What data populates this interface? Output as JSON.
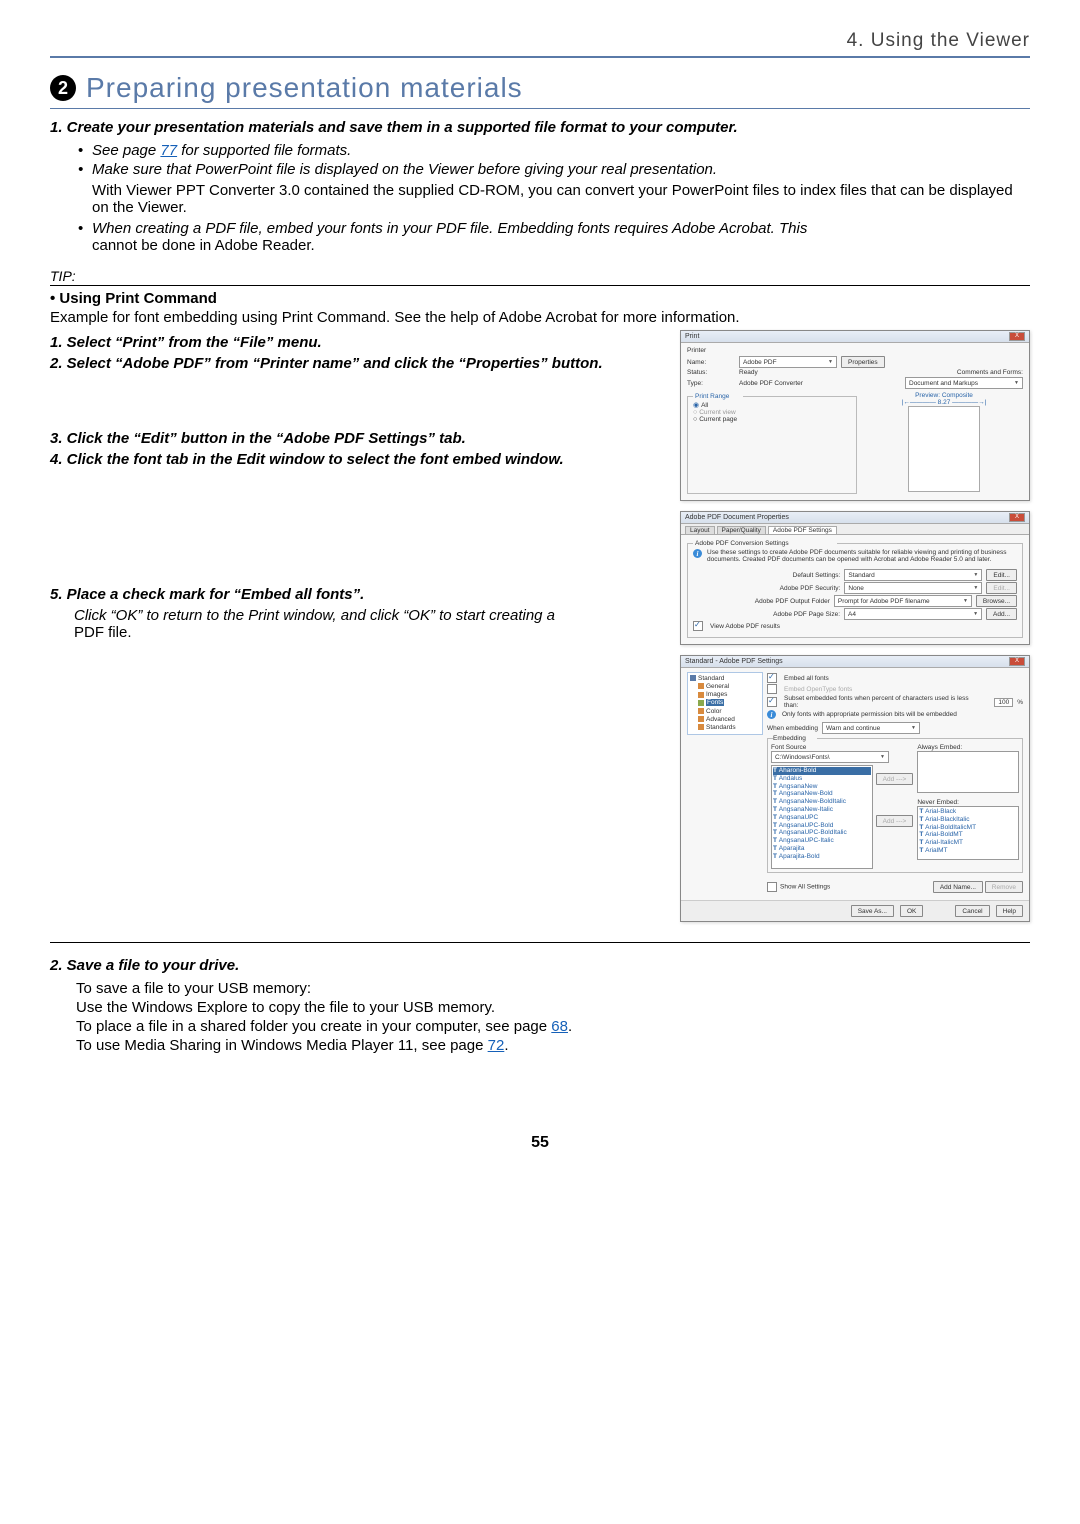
{
  "chapter": "4. Using the Viewer",
  "section_number": "2",
  "section_title": "Preparing presentation materials",
  "steps": {
    "s1": "1. Create your presentation materials and save them in a supported file format to your computer.",
    "bullet1_a": "See page ",
    "bullet1_page": "77",
    "bullet1_b": " for supported ﬁle formats.",
    "bullet2": "Make sure that PowerPoint file is displayed on the Viewer before giving your real presentation.",
    "bullet2_sub": "With Viewer PPT Converter 3.0 contained the supplied CD-ROM, you can convert your PowerPoint ﬁles to index ﬁles that can be displayed on the Viewer.",
    "bullet3_a": "When creating a PDF file, embed your fonts in your PDF file. Embedding fonts requires Adobe Acrobat. This ",
    "bullet3_b": "cannot be done in Adobe Reader."
  },
  "tip_label": "TIP:",
  "print_cmd_title": "• Using Print Command",
  "print_cmd_explain": "Example for font embedding using Print Command. See the help of Adobe Acrobat for more information.",
  "instr": {
    "s1": "1.  Select “Print” from the “File” menu.",
    "s2": "2.  Select “Adobe PDF” from “Printer name” and click the “Properties” button.",
    "s3": "3.  Click the “Edit” button in the “Adobe PDF Settings” tab.",
    "s4": "4.  Click the font tab in the Edit window to select the font embed window.",
    "s5": "5.  Place a check mark for “Embed all fonts”.",
    "s5_sub_a": "Click “OK” to return to the Print window, and click “OK” to start creating a ",
    "s5_sub_b": "PDF ﬁle."
  },
  "printDialog": {
    "title": "Print",
    "name_lbl": "Name:",
    "name_val": "Adobe PDF",
    "properties": "Properties",
    "status_lbl": "Status:",
    "status_val": "Ready",
    "type_lbl": "Type:",
    "type_val": "Adobe PDF Converter",
    "comments_lbl": "Comments and Forms:",
    "comments_val": "Document and Markups",
    "range_lbl": "Print Range",
    "all": "All",
    "cur_view": "Current view",
    "cur_page": "Current page",
    "preview_lbl": "Preview: Composite",
    "preview_size": "8.27"
  },
  "propsDialog": {
    "title": "Adobe PDF Document Properties",
    "tab1": "Layout",
    "tab2": "Paper/Quality",
    "tab3": "Adobe PDF Settings",
    "group": "Adobe PDF Conversion Settings",
    "desc": "Use these settings to create Adobe PDF documents suitable for reliable viewing and printing of business documents. Created PDF documents can be opened with Acrobat and Adobe Reader 5.0 and later.",
    "default_lbl": "Default Settings:",
    "default_val": "Standard",
    "security_lbl": "Adobe PDF Security:",
    "security_val": "None",
    "output_lbl": "Adobe PDF Output Folder",
    "output_val": "Prompt for Adobe PDF filename",
    "pagesize_lbl": "Adobe PDF Page Size:",
    "pagesize_val": "A4",
    "viewresults": "View Adobe PDF results",
    "edit": "Edit...",
    "browse": "Browse...",
    "add": "Add..."
  },
  "fontsDialog": {
    "title": "Standard - Adobe PDF Settings",
    "tree": {
      "root": "Standard",
      "general": "General",
      "images": "Images",
      "fonts": "Fonts",
      "color": "Color",
      "advanced": "Advanced",
      "standards": "Standards"
    },
    "embed_all": "Embed all fonts",
    "embed_ot": "Embed OpenType fonts",
    "subset_a": "Subset embedded fonts when percent of characters used is less",
    "subset_b": "than:",
    "subset_pct": "100",
    "pct": "%",
    "only_perm": "Only fonts with appropriate permission bits will be embedded",
    "when_lbl": "When embedding",
    "when_val": "Warn and continue",
    "emb_group": "Embedding",
    "src_lbl": "Font Source",
    "src_val": "C:\\Windows\\Fonts\\",
    "always_lbl": "Always Embed:",
    "never_lbl": "Never Embed:",
    "add_btn": "Add --->",
    "add_btn2": "Add --->",
    "fonts_src": [
      "Aharoni-Bold",
      "Andalus",
      "AngsanaNew",
      "AngsanaNew-Bold",
      "AngsanaNew-BoldItalic",
      "AngsanaNew-Italic",
      "AngsanaUPC",
      "AngsanaUPC-Bold",
      "AngsanaUPC-BoldItalic",
      "AngsanaUPC-Italic",
      "Aparajita",
      "Aparajita-Bold"
    ],
    "fonts_never": [
      "Arial-Black",
      "Arial-BlackItalic",
      "Arial-BoldItalicMT",
      "Arial-BoldMT",
      "Arial-ItalicMT",
      "ArialMT"
    ],
    "show_all": "Show All Settings",
    "add_name": "Add Name...",
    "remove": "Remove",
    "save_as": "Save As...",
    "ok": "OK",
    "cancel": "Cancel",
    "help": "Help"
  },
  "save": {
    "heading": "2.  Save a file to your drive.",
    "l1": "To save a ﬁle to your USB memory:",
    "l2": "Use the Windows Explore to copy the ﬁle to your USB memory.",
    "l3a": "To place a ﬁle in a shared folder you create in your computer, see page ",
    "l3b": ".",
    "l3_page": "68",
    "l4a": "To use  Media Sharing in Windows Media Player 11, see page ",
    "l4b": ".",
    "l4_page": "72"
  },
  "page_number": "55"
}
